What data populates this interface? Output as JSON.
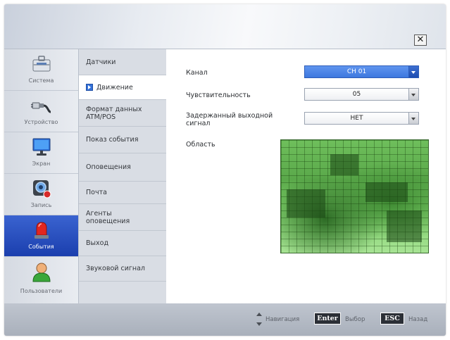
{
  "window": {
    "close_symbol": "✕"
  },
  "sidebar": {
    "items": [
      {
        "label": "Система",
        "icon": "toolbox-icon"
      },
      {
        "label": "Устройство",
        "icon": "cable-plug-icon"
      },
      {
        "label": "Экран",
        "icon": "monitor-icon"
      },
      {
        "label": "Запись",
        "icon": "camera-record-icon"
      },
      {
        "label": "События",
        "icon": "alarm-siren-icon",
        "active": true
      },
      {
        "label": "Пользователи",
        "icon": "user-icon"
      }
    ]
  },
  "submenu": {
    "items": [
      {
        "label": "Датчики"
      },
      {
        "label": "Движение",
        "active": true
      },
      {
        "label": "Формат данных ATM/POS"
      },
      {
        "label": "Показ события"
      },
      {
        "label": "Оповещения"
      },
      {
        "label": "Почта"
      },
      {
        "label": "Агенты оповещения"
      },
      {
        "label": "Выход"
      },
      {
        "label": "Звуковой сигнал"
      }
    ]
  },
  "form": {
    "channel": {
      "label": "Канал",
      "value": "CH 01"
    },
    "sensitivity": {
      "label": "Чувствительность",
      "value": "05"
    },
    "delay_output": {
      "label": "Задержанный выходной сигнал",
      "value": "НЕТ"
    },
    "area": {
      "label": "Область"
    }
  },
  "footer": {
    "nav_label": "Навигация",
    "enter_key": "Enter",
    "enter_label": "Выбор",
    "esc_key": "ESC",
    "esc_label": "Назад"
  },
  "colors": {
    "accent": "#3a63d0",
    "focused_field": "#4a84e6",
    "area_green": "#6fbf5c"
  }
}
